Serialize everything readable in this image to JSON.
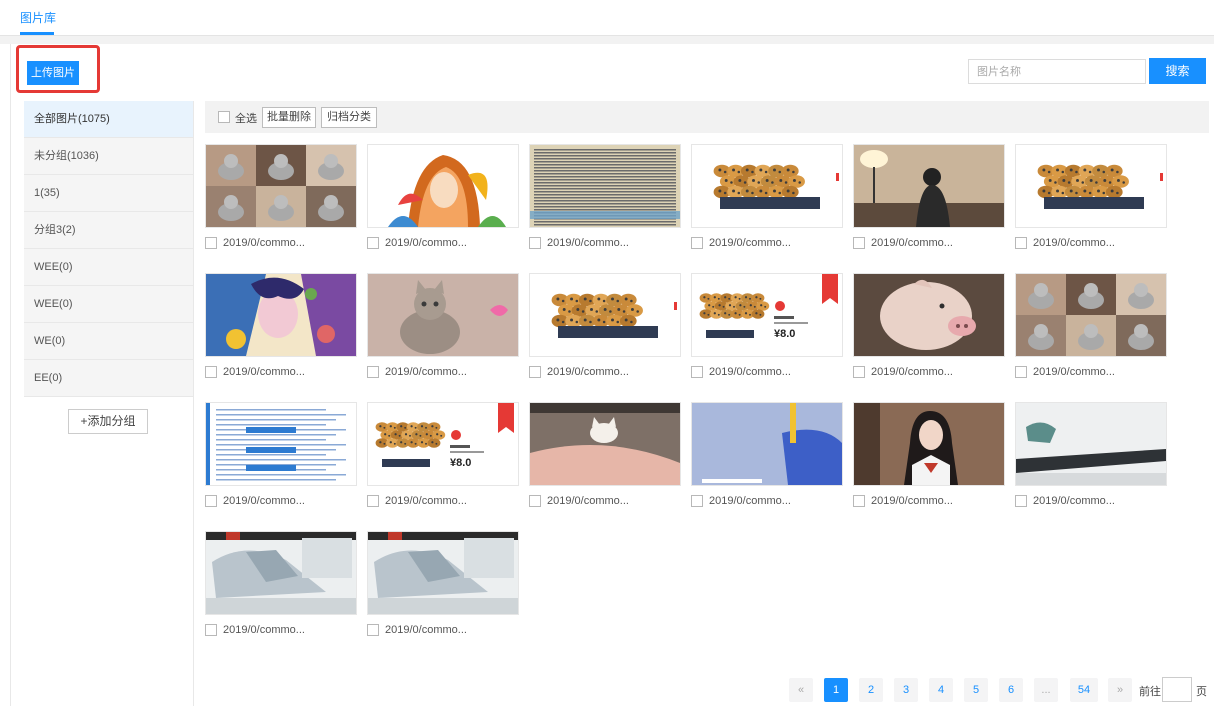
{
  "top_tab": "图片库",
  "upload_label": "上传图片",
  "search": {
    "placeholder": "图片名称",
    "button": "搜索"
  },
  "sidebar": {
    "items": [
      {
        "label": "全部图片(1075)"
      },
      {
        "label": "未分组(1036)"
      },
      {
        "label": "1(35)"
      },
      {
        "label": "分组3(2)"
      },
      {
        "label": "WEE(0)"
      },
      {
        "label": "WEE(0)"
      },
      {
        "label": "WE(0)"
      },
      {
        "label": "EE(0)"
      }
    ],
    "add_group": "+添加分组"
  },
  "toolbar": {
    "select_all": "全选",
    "batch_delete": "批量删除",
    "archive": "归档分类"
  },
  "images": [
    {
      "caption": "2019/0/commo...",
      "kind": "cat-collage"
    },
    {
      "caption": "2019/0/commo...",
      "kind": "colorful-portrait"
    },
    {
      "caption": "2019/0/commo...",
      "kind": "newspaper"
    },
    {
      "caption": "2019/0/commo...",
      "kind": "cookies"
    },
    {
      "caption": "2019/0/commo...",
      "kind": "girl-room"
    },
    {
      "caption": "2019/0/commo...",
      "kind": "cookies"
    },
    {
      "caption": "2019/0/commo...",
      "kind": "colorful-portrait-2"
    },
    {
      "caption": "2019/0/commo...",
      "kind": "grey-cat"
    },
    {
      "caption": "2019/0/commo...",
      "kind": "cookies"
    },
    {
      "caption": "2019/0/commo...",
      "kind": "cookies-price"
    },
    {
      "caption": "2019/0/commo...",
      "kind": "pig"
    },
    {
      "caption": "2019/0/commo...",
      "kind": "cat-collage-2"
    },
    {
      "caption": "2019/0/commo...",
      "kind": "document"
    },
    {
      "caption": "2019/0/commo...",
      "kind": "cookies-price"
    },
    {
      "caption": "2019/0/commo...",
      "kind": "cat-blanket"
    },
    {
      "caption": "2019/0/commo...",
      "kind": "blue-abstract"
    },
    {
      "caption": "2019/0/commo...",
      "kind": "schoolgirl"
    },
    {
      "caption": "2019/0/commo...",
      "kind": "desk"
    },
    {
      "caption": "2019/0/commo...",
      "kind": "lab"
    },
    {
      "caption": "2019/0/commo...",
      "kind": "lab"
    }
  ],
  "price_text": "¥8.0",
  "pagination": {
    "prev": "«",
    "pages": [
      "1",
      "2",
      "3",
      "4",
      "5",
      "6",
      "...",
      "54"
    ],
    "next": "»",
    "current": "1",
    "goto_label": "前往",
    "goto_suffix": "页"
  },
  "colors": {
    "accent": "#1890ff",
    "highlight": "#e53935"
  }
}
